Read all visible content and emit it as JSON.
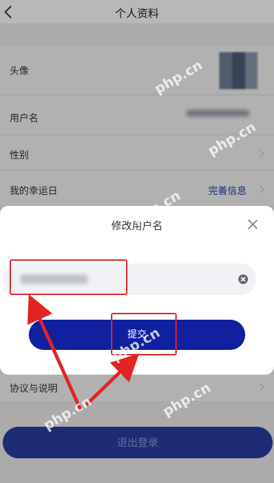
{
  "header": {
    "title": "个人资料"
  },
  "rows": [
    {
      "label": "头像"
    },
    {
      "label": "用户名"
    },
    {
      "label": "性别"
    },
    {
      "label": "我的幸运日",
      "action": "完善信息"
    },
    {
      "label": "协议与说明"
    }
  ],
  "logout": {
    "label": "退出登录"
  },
  "modal": {
    "title": "修改用户名",
    "submit_label": "提交"
  },
  "watermark": {
    "text": "php.cn"
  },
  "colors": {
    "accent": "#10209e",
    "annotation": "#e02424"
  }
}
